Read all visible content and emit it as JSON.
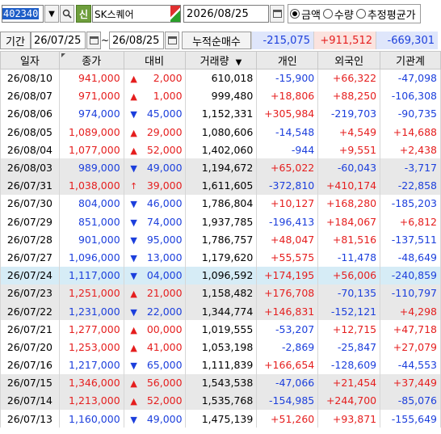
{
  "toolbar": {
    "code": "402340",
    "sin_label": "신",
    "stock_name": "SK스퀘어",
    "date": "2026/08/25",
    "radios": [
      {
        "label": "금액",
        "checked": true
      },
      {
        "label": "수량",
        "checked": false
      },
      {
        "label": "추정평균가",
        "checked": false
      }
    ]
  },
  "period": {
    "label": "기간",
    "from": "26/07/25",
    "to": "26/08/25",
    "cum_label": "누적순매수",
    "sums": [
      "-215,075",
      "+911,512",
      "-669,301"
    ]
  },
  "table": {
    "headers": [
      "일자",
      "종가",
      "대비",
      "거래량",
      "개인",
      "외국인",
      "기관계"
    ],
    "rows": [
      {
        "date": "26/08/10",
        "close": "941,000",
        "dir": "up",
        "chg": "2,000",
        "vol": "610,018",
        "ind": "-15,900",
        "for": "+66,322",
        "inst": "-47,098"
      },
      {
        "date": "26/08/07",
        "close": "971,000",
        "dir": "up",
        "chg": "1,000",
        "vol": "999,480",
        "ind": "+18,806",
        "for": "+88,250",
        "inst": "-106,308"
      },
      {
        "date": "26/08/06",
        "close": "974,000",
        "dir": "down",
        "chg": "45,000",
        "vol": "1,152,331",
        "ind": "+305,984",
        "for": "-219,703",
        "inst": "-90,735"
      },
      {
        "date": "26/08/05",
        "close": "1,089,000",
        "dir": "up",
        "chg": "29,000",
        "vol": "1,080,606",
        "ind": "-14,548",
        "for": "+4,549",
        "inst": "+14,688"
      },
      {
        "date": "26/08/04",
        "close": "1,077,000",
        "dir": "up",
        "chg": "52,000",
        "vol": "1,402,060",
        "ind": "-944",
        "for": "+9,551",
        "inst": "+2,438"
      },
      {
        "date": "26/08/03",
        "close": "989,000",
        "dir": "down",
        "chg": "49,000",
        "vol": "1,194,672",
        "ind": "+65,022",
        "for": "-60,043",
        "inst": "-3,717"
      },
      {
        "date": "26/07/31",
        "close": "1,038,000",
        "dir": "limit",
        "chg": "39,000",
        "vol": "1,611,605",
        "ind": "-372,810",
        "for": "+410,174",
        "inst": "-22,858"
      },
      {
        "date": "26/07/30",
        "close": "804,000",
        "dir": "down",
        "chg": "46,000",
        "vol": "1,786,804",
        "ind": "+10,127",
        "for": "+168,280",
        "inst": "-185,203"
      },
      {
        "date": "26/07/29",
        "close": "851,000",
        "dir": "down",
        "chg": "74,000",
        "vol": "1,937,785",
        "ind": "-196,413",
        "for": "+184,067",
        "inst": "+6,812"
      },
      {
        "date": "26/07/28",
        "close": "901,000",
        "dir": "down",
        "chg": "95,000",
        "vol": "1,786,757",
        "ind": "+48,047",
        "for": "+81,516",
        "inst": "-137,511"
      },
      {
        "date": "26/07/27",
        "close": "1,096,000",
        "dir": "down",
        "chg": "13,000",
        "vol": "1,179,620",
        "ind": "+55,575",
        "for": "-11,478",
        "inst": "-48,649"
      },
      {
        "date": "26/07/24",
        "close": "1,117,000",
        "dir": "down",
        "chg": "04,000",
        "vol": "1,096,592",
        "ind": "+174,195",
        "for": "+56,006",
        "inst": "-240,859"
      },
      {
        "date": "26/07/23",
        "close": "1,251,000",
        "dir": "up",
        "chg": "21,000",
        "vol": "1,158,482",
        "ind": "+176,708",
        "for": "-70,135",
        "inst": "-110,797"
      },
      {
        "date": "26/07/22",
        "close": "1,231,000",
        "dir": "down",
        "chg": "22,000",
        "vol": "1,344,774",
        "ind": "+146,831",
        "for": "-152,121",
        "inst": "+4,298"
      },
      {
        "date": "26/07/21",
        "close": "1,277,000",
        "dir": "up",
        "chg": "00,000",
        "vol": "1,019,555",
        "ind": "-53,207",
        "for": "+12,715",
        "inst": "+47,718"
      },
      {
        "date": "26/07/20",
        "close": "1,253,000",
        "dir": "up",
        "chg": "41,000",
        "vol": "1,053,198",
        "ind": "-2,869",
        "for": "-25,847",
        "inst": "+27,079"
      },
      {
        "date": "26/07/16",
        "close": "1,217,000",
        "dir": "down",
        "chg": "65,000",
        "vol": "1,111,839",
        "ind": "+166,654",
        "for": "-128,609",
        "inst": "-44,553"
      },
      {
        "date": "26/07/15",
        "close": "1,346,000",
        "dir": "up",
        "chg": "56,000",
        "vol": "1,543,538",
        "ind": "-47,066",
        "for": "+21,454",
        "inst": "+37,449"
      },
      {
        "date": "26/07/14",
        "close": "1,213,000",
        "dir": "up",
        "chg": "52,000",
        "vol": "1,535,768",
        "ind": "-154,985",
        "for": "+244,700",
        "inst": "-85,076"
      },
      {
        "date": "26/07/13",
        "close": "1,160,000",
        "dir": "down",
        "chg": "49,000",
        "vol": "1,475,139",
        "ind": "+51,260",
        "for": "+93,871",
        "inst": "-155,649"
      }
    ]
  },
  "colors": {
    "up": "#e51e1e",
    "down": "#1c3fdc",
    "selected_row": "#d6ecf6",
    "shaded_row": "#e8e8e8"
  }
}
